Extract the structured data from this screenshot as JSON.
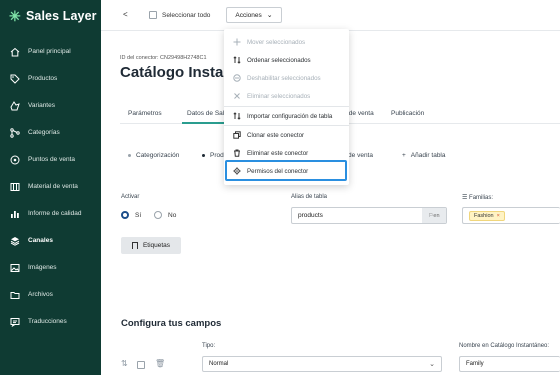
{
  "brand": {
    "name": "Sales Layer"
  },
  "sidebar": {
    "items": [
      {
        "label": "Panel principal",
        "icon": "home-icon"
      },
      {
        "label": "Productos",
        "icon": "tag-icon"
      },
      {
        "label": "Variantes",
        "icon": "variants-icon"
      },
      {
        "label": "Categorías",
        "icon": "hierarchy-icon"
      },
      {
        "label": "Puntos de venta",
        "icon": "location-pin-icon"
      },
      {
        "label": "Material de venta",
        "icon": "catalog-icon"
      },
      {
        "label": "Informe de calidad",
        "icon": "bar-chart-icon"
      },
      {
        "label": "Canales",
        "icon": "layers-icon",
        "active": true
      },
      {
        "label": "Imágenes",
        "icon": "image-icon"
      },
      {
        "label": "Archivos",
        "icon": "folder-icon"
      },
      {
        "label": "Traducciones",
        "icon": "translate-icon"
      }
    ]
  },
  "topbar": {
    "back": "<",
    "select_all": "Seleccionar todo",
    "actions": "Acciones"
  },
  "header": {
    "connector_id": "ID del conector: CN29498H2748C1",
    "title": "Catálogo Instantáneo"
  },
  "tabs": [
    "Parámetros",
    "Datos de Sales Layer",
    "Datos de venta",
    "Publicación"
  ],
  "chips": [
    "Categorización",
    "Productos",
    "Puntos de venta",
    "Añadir tabla"
  ],
  "form": {
    "activar_label": "Activar",
    "si": "Sí",
    "no": "No",
    "etiquetas": "Etiquetas",
    "alias_label": "Alias de tabla",
    "alias_value": "products",
    "alias_suffix": "en",
    "familias_label": "Familias:",
    "familias_tag": "Fashion"
  },
  "configura": {
    "title": "Configura tus campos",
    "tipo_label": "Tipo:",
    "tipo_value": "Normal",
    "nombre_label": "Nombre en Catálogo Instantáneo:",
    "nombre_value": "Family"
  },
  "dropdown": {
    "items": [
      {
        "label": "Mover seleccionados",
        "disabled": true,
        "icon": "move-icon"
      },
      {
        "label": "Ordenar seleccionados",
        "disabled": false,
        "icon": "sort-icon"
      },
      {
        "label": "Deshabilitar seleccionados",
        "disabled": true,
        "icon": "disable-icon"
      },
      {
        "label": "Eliminar seleccionados",
        "disabled": true,
        "icon": "close-icon"
      },
      {
        "label": "Importar configuración de tabla",
        "disabled": false,
        "icon": "sort-icon"
      },
      {
        "label": "Clonar este conector",
        "disabled": false,
        "icon": "clone-icon"
      },
      {
        "label": "Eliminar este conector",
        "disabled": false,
        "icon": "trash-icon"
      },
      {
        "label": "Permisos del conector",
        "disabled": false,
        "icon": "gear-icon"
      }
    ]
  },
  "colors": {
    "sidebar": "#0f3b33",
    "accent": "#2a9d8f",
    "highlight": "#2a8fe0"
  }
}
